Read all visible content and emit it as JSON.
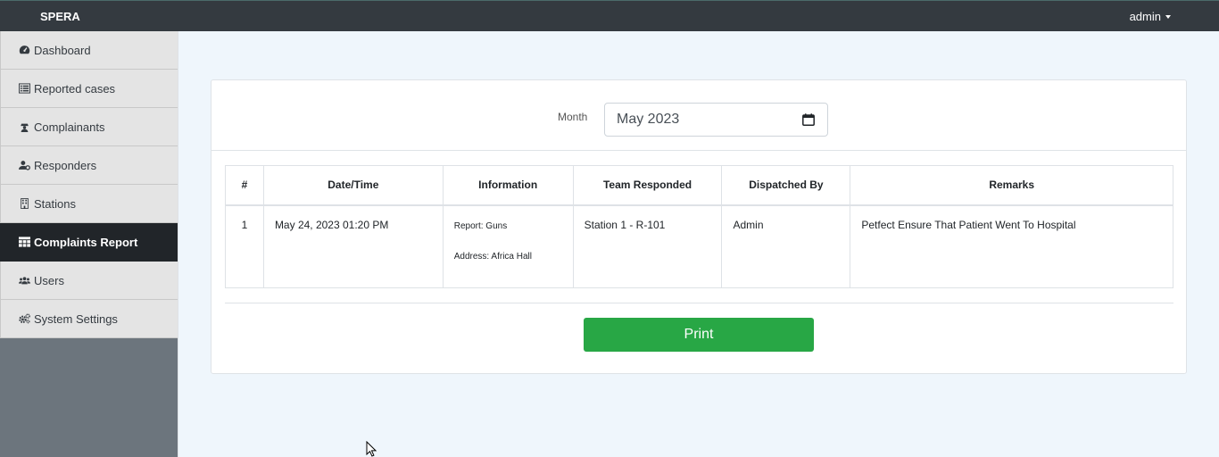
{
  "app": {
    "brand": "SPERA",
    "user": "admin"
  },
  "sidebar": {
    "items": [
      {
        "label": "Dashboard",
        "icon": "dashboard-icon"
      },
      {
        "label": "Reported cases",
        "icon": "list-icon"
      },
      {
        "label": "Complainants",
        "icon": "users-icon"
      },
      {
        "label": "Responders",
        "icon": "user-cog-icon"
      },
      {
        "label": "Stations",
        "icon": "building-icon"
      },
      {
        "label": "Complaints Report",
        "icon": "table-icon",
        "active": true
      },
      {
        "label": "Users",
        "icon": "group-icon"
      },
      {
        "label": "System Settings",
        "icon": "cogs-icon"
      }
    ]
  },
  "filter": {
    "label": "Month",
    "value": "May 2023"
  },
  "table": {
    "headers": [
      "#",
      "Date/Time",
      "Information",
      "Team Responded",
      "Dispatched By",
      "Remarks"
    ],
    "rows": [
      {
        "num": "1",
        "datetime": "May 24, 2023 01:20 PM",
        "report": "Report: Guns",
        "address": "Address: Africa Hall",
        "team": "Station 1 - R-101",
        "dispatched_by": "Admin",
        "remarks": "Petfect Ensure That Patient Went To Hospital"
      }
    ]
  },
  "actions": {
    "print_label": "Print"
  },
  "colors": {
    "topbar": "#343a40",
    "sidebar_active": "#212529",
    "print_button": "#28a745",
    "page_bg": "#eff6fc"
  }
}
